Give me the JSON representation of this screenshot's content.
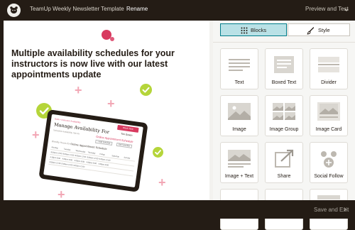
{
  "header": {
    "logo_icon": "mailchimp-logo-icon",
    "title": "TeamUp Weekly Newsletter Template",
    "rename_label": "Rename",
    "preview_label": "Preview and Test"
  },
  "canvas": {
    "headline": "Multiple availability schedules for your instructors is now live with our latest appointments update",
    "tablet": {
      "back_link": "Back • Instructor Availability",
      "title": "Manage Availability For",
      "block_button": "Block Time",
      "user_name": "Tim Green",
      "subtitle": "Schedule Availability Slot for",
      "schedule_name": "Online Appointment Schedule",
      "pill_add": "+ Add Schedule",
      "pill_edit": "Edit Schedule",
      "hours_label": "Weekly Hours for",
      "hours_schedule": "Online Appointment Schedule",
      "days": [
        "Monday",
        "Tuesday",
        "Wednesday",
        "Thursday",
        "Friday",
        "Saturday",
        "Sunday"
      ],
      "rows": [
        [
          "9:00am-12:00",
          "9:00am-12:00",
          "9:00am-12:00",
          "9:00am-12:00",
          "9:00am-12:00",
          "",
          ""
        ],
        [
          "4:00pm-8:00",
          "4:00pm-8:00",
          "4:00pm-8:00",
          "4:00pm-8:00",
          "4:00pm-8:00",
          "",
          ""
        ],
        [
          "9:00am-12:00",
          "9:00am-12:00",
          "9:00am-12:00",
          "",
          "",
          "",
          ""
        ]
      ]
    }
  },
  "panel": {
    "tabs": [
      {
        "label": "Blocks",
        "icon": "grid-dots-icon",
        "active": true
      },
      {
        "label": "Style",
        "icon": "paint-brush-icon",
        "active": false
      }
    ],
    "blocks": [
      {
        "label": "Text",
        "icon": "text-lines-icon"
      },
      {
        "label": "Boxed Text",
        "icon": "boxed-text-icon"
      },
      {
        "label": "Divider",
        "icon": "divider-icon"
      },
      {
        "label": "Image",
        "icon": "image-icon"
      },
      {
        "label": "Image Group",
        "icon": "image-group-icon"
      },
      {
        "label": "Image Card",
        "icon": "image-card-icon"
      },
      {
        "label": "Image + Text",
        "icon": "image-text-icon"
      },
      {
        "label": "Share",
        "icon": "share-icon"
      },
      {
        "label": "Social Follow",
        "icon": "social-follow-icon"
      }
    ]
  },
  "footer": {
    "save_label": "Save and Exit"
  },
  "colors": {
    "chrome": "#241c15",
    "accent_teal": "#007c89",
    "tab_active_bg": "#b9e1e6",
    "pink": "#f2a7b5",
    "magenta": "#d83a5f",
    "lime": "#b5d53a"
  }
}
